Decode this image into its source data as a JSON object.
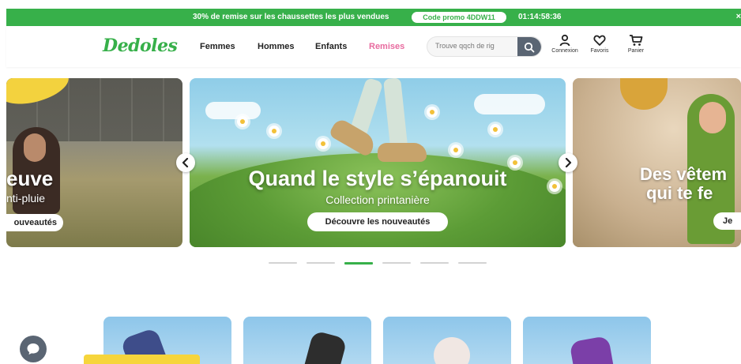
{
  "promo": {
    "text": "30% de remise sur les chaussettes les plus vendues",
    "code": "Code promo 4DDW11",
    "timer": "01:14:58:36",
    "close": "×"
  },
  "header": {
    "logo": "Dedoles",
    "nav": [
      "Femmes",
      "Hommes",
      "Enfants",
      "Remises"
    ],
    "search_placeholder": "Trouve qqch de rig",
    "icons": [
      {
        "label": "Connexion",
        "icon": "user-icon"
      },
      {
        "label": "Favoris",
        "icon": "heart-icon"
      },
      {
        "label": "Panier",
        "icon": "cart-icon"
      }
    ]
  },
  "carousel": {
    "left": {
      "title": "euve",
      "subtitle": "nti-pluie",
      "cta": "ouveautés"
    },
    "center": {
      "title": "Quand le style s’épanouit",
      "subtitle": "Collection printanière",
      "cta": "Découvre les nouveautés"
    },
    "right": {
      "title_line1": "Des vêtem",
      "title_line2": "qui te fe",
      "cta": "Je"
    },
    "dots_count": 6,
    "active_dot": 3
  },
  "colors": {
    "brand_green": "#37b04a",
    "sale_pink": "#e86b9f"
  }
}
